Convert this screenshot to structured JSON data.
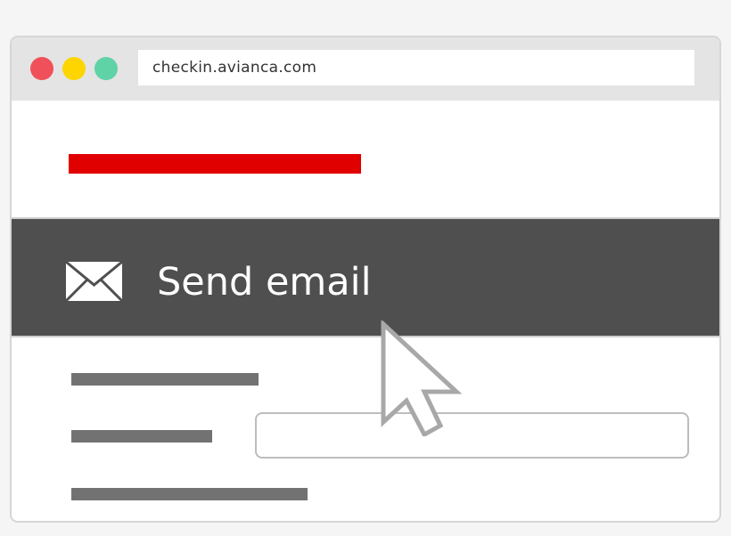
{
  "browser": {
    "url": "checkin.avianca.com",
    "buttons": [
      "close",
      "minimize",
      "maximize"
    ]
  },
  "colors": {
    "close": "#f0505a",
    "minimize": "#fed500",
    "maximize": "#5fd2a6",
    "accent": "#e10000",
    "band": "#4f4f4f"
  },
  "band": {
    "icon": "mail-icon",
    "label": "Send email"
  },
  "cursor": {
    "icon": "mouse-pointer-icon"
  }
}
